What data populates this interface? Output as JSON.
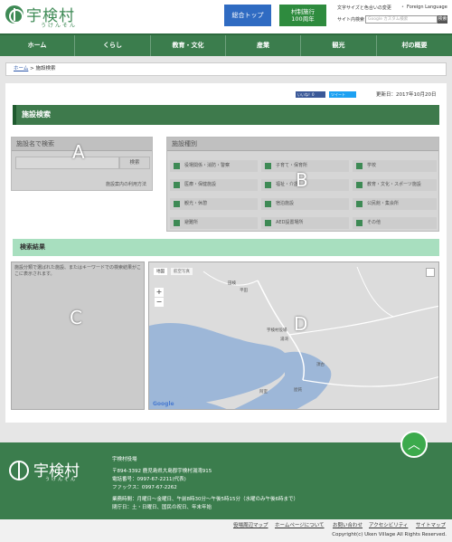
{
  "header": {
    "logo_title": "宇検村",
    "logo_kana": "うけんそん",
    "top_button": "総合トップ",
    "anniv_button_line1": "村制施行",
    "anniv_button_line2": "100周年",
    "font_size_label": "文字サイズと色合いの変更",
    "foreign_language": "Foreign Language",
    "site_search_label": "サイト内検索",
    "search_placeholder": "Google カスタム検索",
    "search_button": "検索"
  },
  "nav": {
    "items": [
      "ホーム",
      "くらし",
      "教育・文化",
      "産業",
      "観光",
      "村の概要"
    ]
  },
  "breadcrumb": {
    "home": "ホーム",
    "separator": ">",
    "current": "施設検索"
  },
  "main": {
    "like_label": "いいね！0",
    "tweet_label": "ツイート",
    "updated": "更新日：2017年10月20日",
    "page_title": "施設検索",
    "name_search": {
      "title": "施設名で検索",
      "button": "検索",
      "link": "施設案内の利用方法",
      "annotation": "A"
    },
    "category": {
      "title": "施設種別",
      "annotation": "B",
      "items": [
        "役場関係・消防・警察",
        "子育て・保育所",
        "学校",
        "医療・保健施設",
        "福祉・介護",
        "教育・文化・スポーツ施設",
        "観光・休憩",
        "宿泊施設",
        "公民館・集会所",
        "避難所",
        "AED設置場所",
        "その他"
      ]
    },
    "results": {
      "title": "検索結果",
      "message": "施設分類で選ばれた施設、またはキーワードでの検索結果がここに表示されます。",
      "annotation": "C"
    },
    "map": {
      "annotation": "D",
      "tab_map": "地図",
      "tab_satellite": "航空写真",
      "zoom_in": "+",
      "zoom_out": "−",
      "provider": "Google",
      "labels": [
        "田検",
        "宇検村役場",
        "湯湾",
        "須古",
        "屋鈍",
        "阿室",
        "平田"
      ]
    }
  },
  "footer": {
    "logo_title": "宇検村",
    "logo_kana": "うけんそん",
    "office_name": "宇検村役場",
    "address": "〒894-3392 鹿児島県大島郡宇検村湯湾915",
    "phone": "電話番号：0997-67-2211(代表)",
    "fax": "ファックス：0997-67-2262",
    "hours": "業務時間：月曜日～金曜日、午前8時30分～午後5時15分（水曜のみ午後6時まで）",
    "closed": "閉庁日：土・日曜日、国民の祝日、年末年始",
    "scroll_top": "︿",
    "links": [
      "役場周辺マップ",
      "ホームページについて",
      "お問い合わせ",
      "アクセシビリティ",
      "サイトマップ"
    ],
    "copyright": "Copyright(c) Uken Village All Rights Reserved."
  },
  "colors": {
    "brand_green": "#3b7d4d",
    "accent_blue": "#2f6bc2",
    "result_bar": "#a8dfbf"
  }
}
